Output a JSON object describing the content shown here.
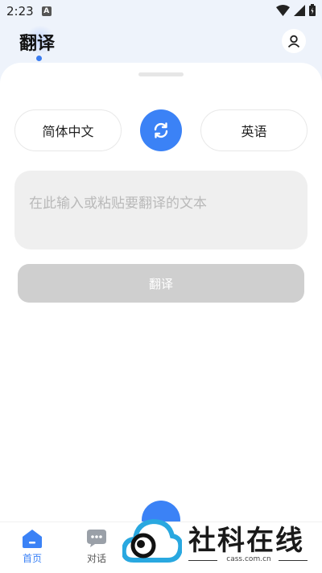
{
  "status_bar": {
    "time": "2:23",
    "notification_letter": "A"
  },
  "header": {
    "title": "翻译"
  },
  "languages": {
    "source": "简体中文",
    "target": "英语"
  },
  "input": {
    "placeholder": "在此输入或粘贴要翻译的文本"
  },
  "translate_button": {
    "label": "翻译"
  },
  "bottom_nav": {
    "items": [
      {
        "label": "首页"
      },
      {
        "label": "对话"
      }
    ]
  },
  "watermark": {
    "brand": "社科在线",
    "domain": "cass.com.cn"
  },
  "colors": {
    "accent": "#3b82f6",
    "button_disabled": "#cfcfcf"
  },
  "icons": [
    "wifi-icon",
    "signal-icon",
    "battery-icon",
    "user-icon",
    "swap-icon",
    "home-icon",
    "chat-icon",
    "cloud-eye-logo-icon"
  ]
}
